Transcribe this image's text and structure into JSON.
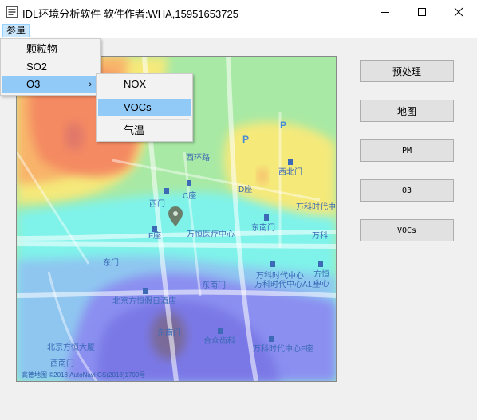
{
  "window": {
    "title": "IDL环境分析软件  软件作者:WHA,15951653725"
  },
  "menubar": {
    "items": [
      {
        "label": "参量"
      }
    ]
  },
  "menu_param": {
    "items": [
      {
        "label": "颗粒物"
      },
      {
        "label": "SO2"
      },
      {
        "label": "O3",
        "submenu_arrow": "›"
      }
    ]
  },
  "menu_o3": {
    "items": [
      {
        "label": "NOX"
      },
      {
        "label": "VOCs"
      },
      {
        "label": "气温"
      }
    ]
  },
  "buttons": {
    "preprocess": "预处理",
    "map": "地图",
    "pm": "PM",
    "o3": "O3",
    "vocs": "VOCs"
  },
  "map": {
    "labels": [
      "西环路",
      "西北门",
      "D座",
      "西门",
      "C座",
      "F座",
      "万恒医疗中心",
      "东南门",
      "万科时代中心",
      "万科时代中心A1座",
      "北京方恒假日酒店",
      "东南门",
      "东南门",
      "合众齿科",
      "万科时代中心F座",
      "北京方恒大厦",
      "西南门",
      "万科时代中心",
      "东门",
      "万科",
      "方恒",
      "中心"
    ],
    "attribution": "高德地图 ©2018 AutoNavi GS(2018)1709号"
  },
  "colors": {
    "menu_highlight": "#91c9f7",
    "menu_top_highlight": "#cce8ff"
  }
}
